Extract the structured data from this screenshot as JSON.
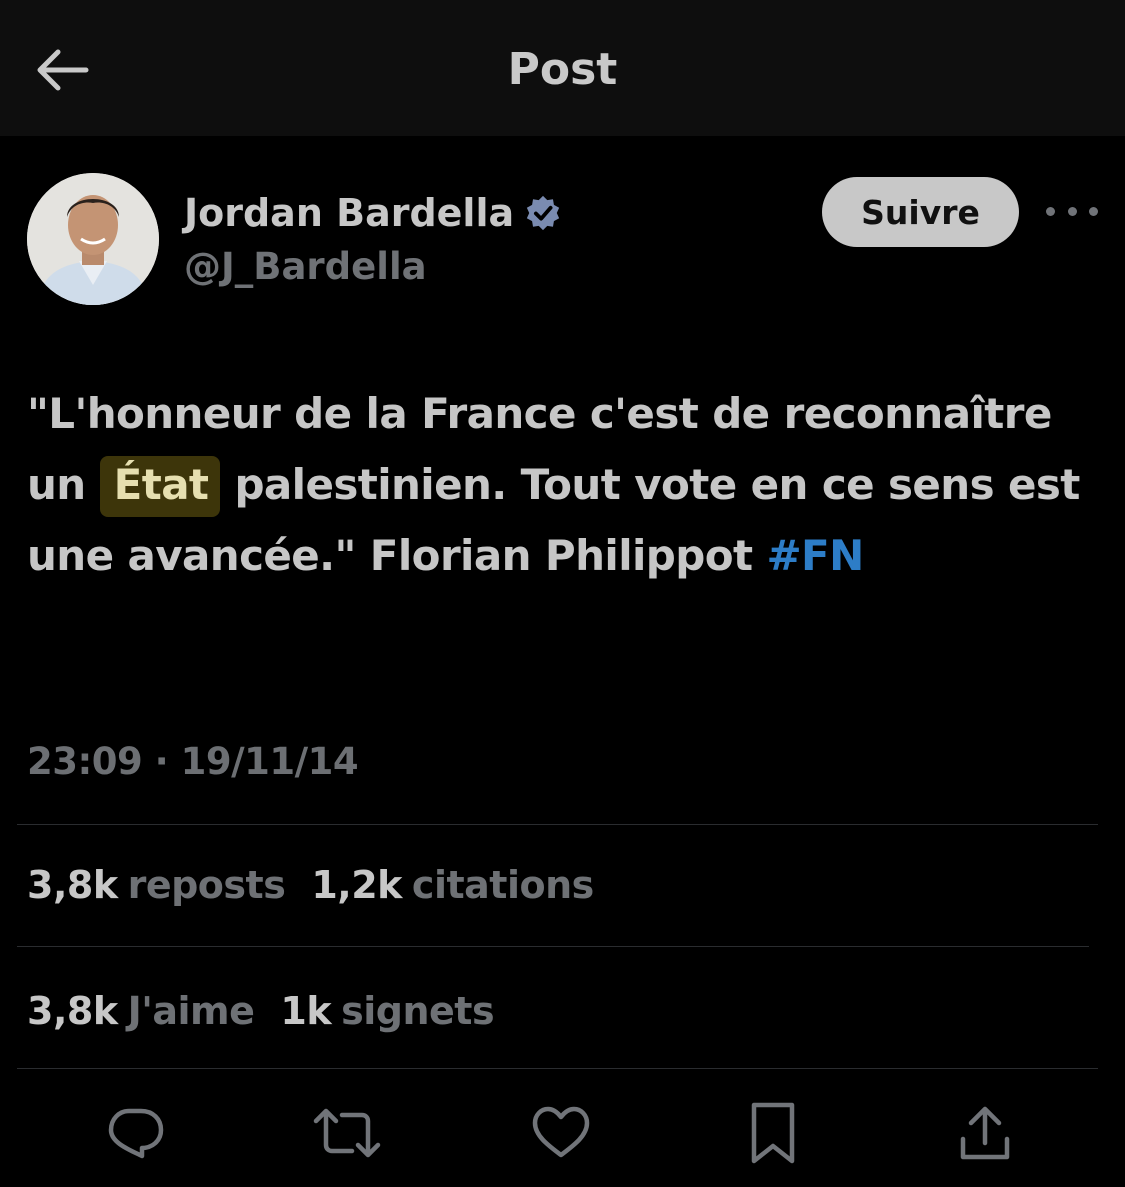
{
  "header": {
    "title": "Post",
    "back_icon": "arrow-left-icon"
  },
  "author": {
    "name": "Jordan Bardella",
    "handle": "@J_Bardella",
    "verified_icon": "verified-badge-icon",
    "verified_color": "#7a8bb0"
  },
  "follow_button": {
    "label": "Suivre"
  },
  "more_icon": "more-horizontal-icon",
  "tweet": {
    "part1": "\"L'honneur de la France c'est de reconnaître un ",
    "highlight": "État",
    "part2": " palestinien. Tout vote en ce sens est une avancée.\" Florian Philippot ",
    "hashtag": "#FN",
    "highlight_color": "#3d350a",
    "hashtag_color": "#2d7dc7"
  },
  "timestamp": "23:09 · 19/11/14",
  "stats": {
    "reposts": {
      "count": "3,8k",
      "label": "reposts"
    },
    "quotes": {
      "count": "1,2k",
      "label": "citations"
    },
    "likes": {
      "count": "3,8k",
      "label": "J'aime"
    },
    "bookmarks": {
      "count": "1k",
      "label": "signets"
    }
  },
  "actions": [
    "reply-icon",
    "repost-icon",
    "like-icon",
    "bookmark-icon",
    "share-icon"
  ]
}
